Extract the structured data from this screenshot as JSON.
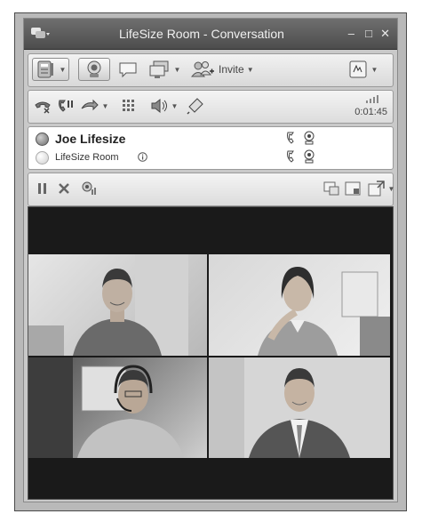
{
  "window": {
    "title": "LifeSize Room - Conversation",
    "controls": {
      "minimize": "–",
      "maximize": "□",
      "close": "✕"
    }
  },
  "toolbar": {
    "invite_label": "Invite",
    "dropdown_glyph": "▼",
    "icons": [
      "phone-book-icon",
      "webcam-icon",
      "chat-bubble-icon",
      "monitor-share-icon",
      "add-people-icon",
      "notes-icon"
    ]
  },
  "call": {
    "timer": "0:01:45",
    "icons": [
      "hang-up-icon",
      "hold-icon",
      "transfer-icon",
      "dialpad-icon",
      "speaker-icon",
      "microphone-icon",
      "signal-strength-icon"
    ]
  },
  "participants": [
    {
      "name": "Joe Lifesize",
      "status": "active"
    },
    {
      "name": "LifeSize Room",
      "status": "idle"
    }
  ],
  "video_controls": {
    "icons": [
      "pause-icon",
      "stop-icon",
      "camera-settings-icon",
      "picture-in-picture-icon",
      "layout-icon",
      "popout-icon"
    ]
  },
  "video": {
    "tiles": [
      "participant-video-1",
      "participant-video-2",
      "participant-video-3",
      "participant-video-4"
    ]
  },
  "colors": {
    "frame": "#b9b9b9",
    "titlebar": "#5e5e5e",
    "panel": "#e8e8e8",
    "video_bg": "#1a1a1a"
  }
}
